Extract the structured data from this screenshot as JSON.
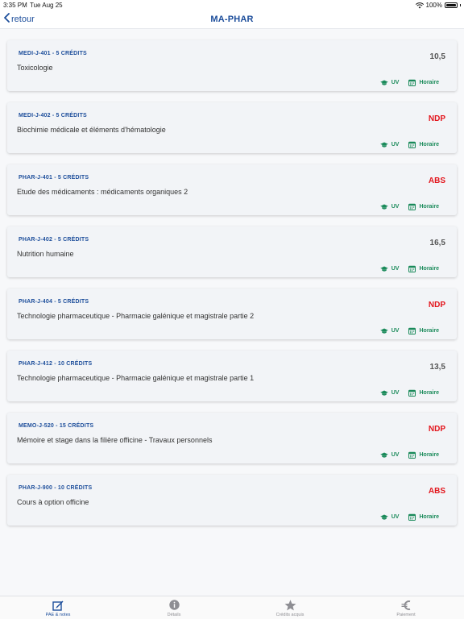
{
  "status_bar": {
    "time": "3:35 PM",
    "date": "Tue Aug 25",
    "battery": "100%"
  },
  "nav": {
    "back_label": "retour",
    "title": "MA-PHAR"
  },
  "colors": {
    "accent": "#1d4e9b",
    "action": "#1a8a5a",
    "alert": "#e3141b"
  },
  "courses": [
    {
      "code": "MEDI-J-401 - 5 CRÉDITS",
      "title": "Toxicologie",
      "grade": "10,5",
      "uv_label": "UV",
      "schedule_label": "Horaire"
    },
    {
      "code": "MEDI-J-402 - 5 CRÉDITS",
      "title": "Biochimie médicale et éléments d'hématologie",
      "grade": "NDP",
      "uv_label": "UV",
      "schedule_label": "Horaire"
    },
    {
      "code": "PHAR-J-401 - 5 CRÉDITS",
      "title": "Etude des médicaments : médicaments organiques 2",
      "grade": "ABS",
      "uv_label": "UV",
      "schedule_label": "Horaire"
    },
    {
      "code": "PHAR-J-402 - 5 CRÉDITS",
      "title": "Nutrition humaine",
      "grade": "16,5",
      "uv_label": "UV",
      "schedule_label": "Horaire"
    },
    {
      "code": "PHAR-J-404 - 5 CRÉDITS",
      "title": "Technologie pharmaceutique - Pharmacie galénique et magistrale partie 2",
      "grade": "NDP",
      "uv_label": "UV",
      "schedule_label": "Horaire"
    },
    {
      "code": "PHAR-J-412 - 10 CRÉDITS",
      "title": "Technologie pharmaceutique - Pharmacie galénique et magistrale partie 1",
      "grade": "13,5",
      "uv_label": "UV",
      "schedule_label": "Horaire"
    },
    {
      "code": "MEMO-J-520 - 15 CRÉDITS",
      "title": "Mémoire et stage dans la filière officine - Travaux personnels",
      "grade": "NDP",
      "uv_label": "UV",
      "schedule_label": "Horaire"
    },
    {
      "code": "PHAR-J-900 - 10 CRÉDITS",
      "title": "Cours à option officine",
      "grade": "ABS",
      "uv_label": "UV",
      "schedule_label": "Horaire"
    }
  ],
  "tabs": [
    {
      "label": "PAE & notes",
      "icon": "edit-icon",
      "active": true
    },
    {
      "label": "Détails",
      "icon": "info-icon",
      "active": false
    },
    {
      "label": "Crédits acquis",
      "icon": "star-icon",
      "active": false
    },
    {
      "label": "Paiement",
      "icon": "euro-icon",
      "active": false
    }
  ]
}
